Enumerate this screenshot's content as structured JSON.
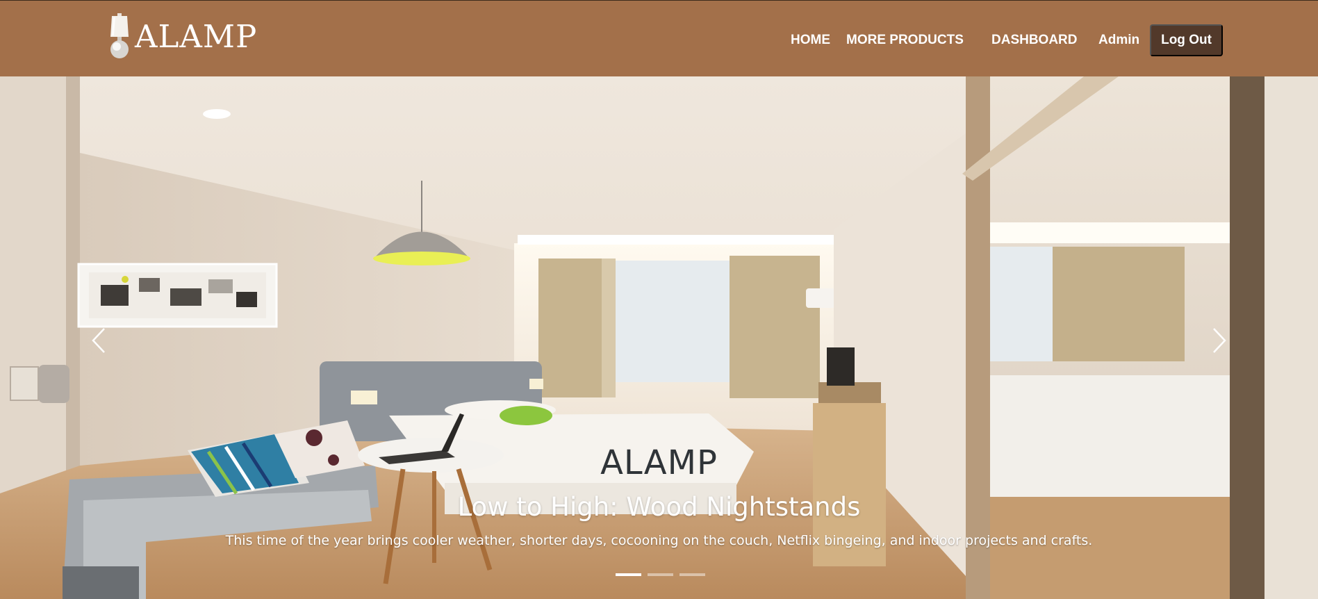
{
  "brand": {
    "name": "ALAMP",
    "logo_icon": "lamp-icon"
  },
  "nav": {
    "home": "HOME",
    "more_products": "MORE PRODUCTS",
    "dashboard": "DASHBOARD",
    "user": "Admin",
    "logout": "Log Out"
  },
  "carousel": {
    "slides": [
      {
        "title": "ALAMP",
        "subtitle": "Low to High: Wood Nightstands",
        "description": "This time of the year brings cooler weather, shorter days, cocooning on the couch, Netflix bingeing, and indoor projects and crafts."
      }
    ],
    "indicator_count": 3,
    "active_index": 0,
    "prev_icon": "chevron-left-icon",
    "next_icon": "chevron-right-icon"
  },
  "colors": {
    "navbar": "#a3704a",
    "logout_button": "#52392a",
    "caption_title": "#2f3438"
  }
}
